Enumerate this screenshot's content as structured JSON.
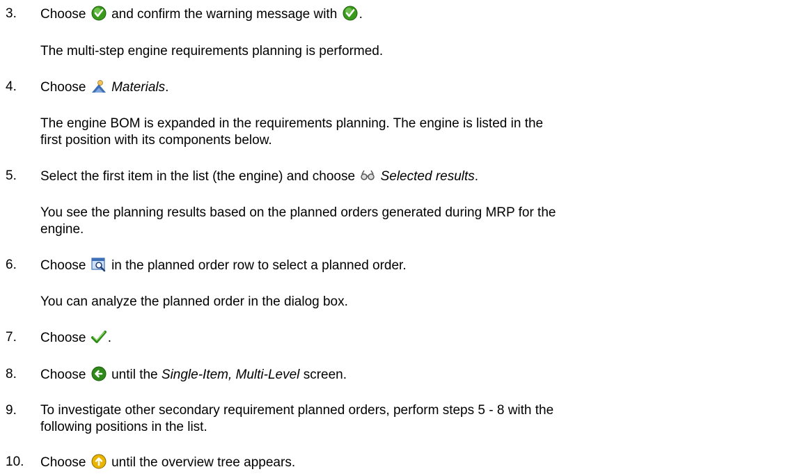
{
  "steps": [
    {
      "number": "3.",
      "before": "Choose",
      "middle": "and confirm the warning message with",
      "after": ".",
      "icon1": "green-check-circle-icon",
      "icon2": "green-check-circle-icon",
      "result": "The multi-step engine requirements planning is performed."
    },
    {
      "number": "4.",
      "before": "Choose",
      "term": "Materials",
      "after": ".",
      "icon": "materials-person-icon",
      "result_line1": "The engine BOM is expanded in the requirements planning. The engine is listed in the",
      "result_line2": "first position with its components below."
    },
    {
      "number": "5.",
      "before": "Select the first item in the list (the engine) and choose",
      "term": "Selected results",
      "after": ".",
      "icon": "glasses-icon",
      "result_line1": "You see the planning results based on the planned orders generated during MRP for the",
      "result_line2": "engine."
    },
    {
      "number": "6.",
      "before": "Choose",
      "after": "in the planned order row to select a planned order.",
      "icon": "detail-magnifier-icon",
      "result": "You can analyze the planned order in the dialog box."
    },
    {
      "number": "7.",
      "before": "Choose",
      "after": ".",
      "icon": "checkmark-icon"
    },
    {
      "number": "8.",
      "before": "Choose",
      "middle": "until the",
      "term": "Single-Item, Multi-Level",
      "after": "screen.",
      "icon": "back-arrow-icon"
    },
    {
      "number": "9.",
      "line1": "To investigate other secondary requirement planned orders, perform steps 5 - 8 with the",
      "line2": "following positions in the list."
    },
    {
      "number": "10.",
      "before": "Choose",
      "after": "until the overview tree appears.",
      "icon": "up-arrow-icon"
    }
  ],
  "colors": {
    "check_green": "#3a9a1c",
    "arrow_green": "#2f8a1a",
    "icon_blue": "#3d6fb6",
    "up_yellow": "#e8b400"
  }
}
